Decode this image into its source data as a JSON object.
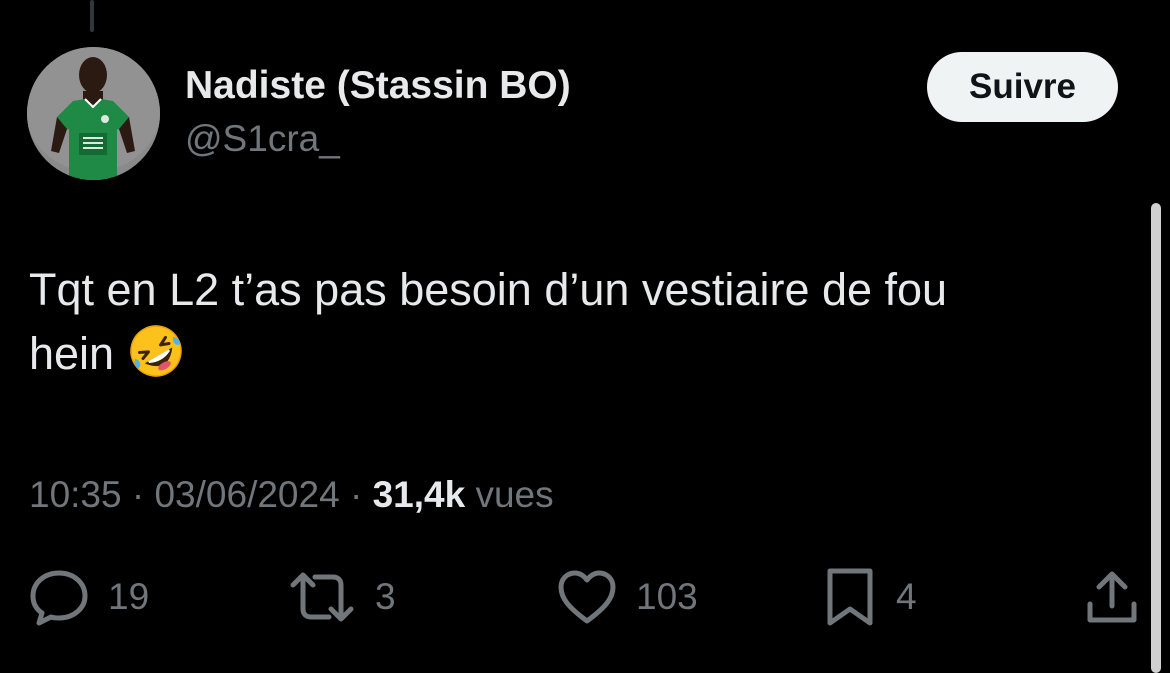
{
  "tweet": {
    "author": {
      "display_name": "Nadiste (Stassin BO)",
      "handle": "@S1cra_",
      "avatar": "player-in-green-jersey"
    },
    "follow_label": "Suivre",
    "text_line1": "Tqt en L2 t’as pas besoin d’un vestiaire de fou",
    "text_line2": "hein",
    "emoji": "rolling-on-the-floor-laughing",
    "time": "10:35",
    "separator": "·",
    "date": "03/06/2024",
    "views_count": "31,4k",
    "views_label": "vues",
    "stats": {
      "replies": "19",
      "retweets": "3",
      "likes": "103",
      "bookmarks": "4"
    }
  },
  "colors": {
    "background": "#000000",
    "primary_text": "#e7e9ea",
    "secondary_text": "#71767b",
    "follow_button_bg": "#eff3f4",
    "follow_button_text": "#0f1419",
    "jersey_green": "#1e8a45"
  },
  "icons": {
    "reply": "speech-bubble-icon",
    "retweet": "retweet-arrows-icon",
    "like": "heart-icon",
    "bookmark": "bookmark-icon",
    "share": "share-upload-icon"
  }
}
